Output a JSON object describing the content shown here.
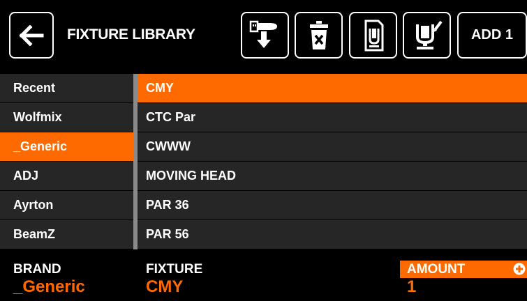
{
  "header": {
    "title": "FIXTURE LIBRARY",
    "add_label": "ADD 1"
  },
  "brands": [
    {
      "label": "Recent",
      "selected": false
    },
    {
      "label": "Wolfmix",
      "selected": false
    },
    {
      "label": "_Generic",
      "selected": true
    },
    {
      "label": "ADJ",
      "selected": false
    },
    {
      "label": "Ayrton",
      "selected": false
    },
    {
      "label": "BeamZ",
      "selected": false
    }
  ],
  "fixtures": [
    {
      "label": "CMY",
      "selected": true
    },
    {
      "label": "CTC Par",
      "selected": false
    },
    {
      "label": "CWWW",
      "selected": false
    },
    {
      "label": "MOVING HEAD",
      "selected": false
    },
    {
      "label": "PAR 36",
      "selected": false
    },
    {
      "label": "PAR 56",
      "selected": false
    }
  ],
  "footer": {
    "brand_label": "BRAND",
    "brand_value": "_Generic",
    "fixture_label": "FIXTURE",
    "fixture_value": "CMY",
    "amount_label": "AMOUNT",
    "amount_value": "1"
  },
  "colors": {
    "accent": "#ff6a00",
    "row_bg": "#262626",
    "background": "#000000"
  }
}
